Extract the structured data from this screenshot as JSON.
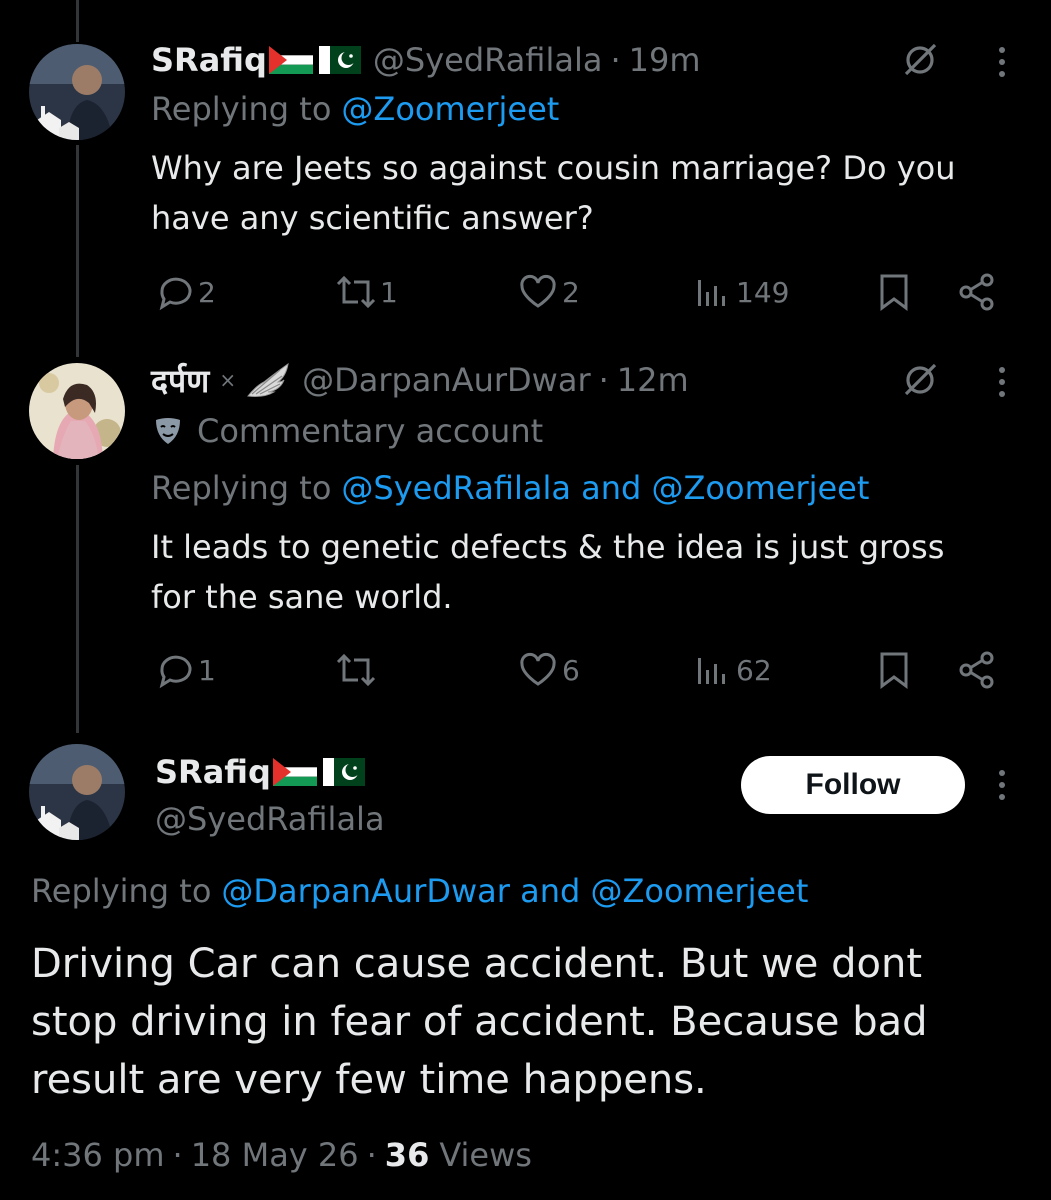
{
  "tweets": [
    {
      "display_name": "SRafiq",
      "handle": "@SyedRafilala",
      "time": "19m",
      "replying_prefix": "Replying to",
      "replying_to": "@Zoomerjeet",
      "text_line1": "Why are Jeets so against cousin marriage? Do you",
      "text_line2": "have any scientific answer?",
      "replies": "2",
      "reposts": "1",
      "likes": "2",
      "views": "149"
    },
    {
      "display_name": "दर्पण",
      "handle": "@DarpanAurDwar",
      "time": "12m",
      "badge_label": "Commentary account",
      "replying_prefix": "Replying to",
      "replying_to": "@SyedRafilala and @Zoomerjeet",
      "text_line1": "It leads to genetic defects & the idea is just gross",
      "text_line2": "for the sane world.",
      "replies": "1",
      "reposts": "",
      "likes": "6",
      "views": "62"
    }
  ],
  "main_tweet": {
    "display_name": "SRafiq",
    "handle": "@SyedRafilala",
    "follow_label": "Follow",
    "replying_prefix": "Replying to",
    "replying_to": "@DarpanAurDwar and @Zoomerjeet",
    "text_line1": "Driving Car can cause accident. But we dont",
    "text_line2": "stop driving in fear of accident. Because bad",
    "text_line3": "result are very few time happens.",
    "time": "4:36 pm",
    "date": "18 May 26",
    "views_count": "36",
    "views_label": "Views"
  },
  "colors": {
    "accent": "#1d9bf0",
    "muted": "#71767b",
    "text": "#e7e9ea",
    "bg": "#000000"
  },
  "icons": [
    "grok-icon",
    "more-icon",
    "reply-icon",
    "repost-icon",
    "like-icon",
    "views-icon",
    "bookmark-icon",
    "share-icon",
    "palestine-flag-icon",
    "pakistan-flag-icon",
    "wing-icon",
    "commentary-mask-icon"
  ]
}
